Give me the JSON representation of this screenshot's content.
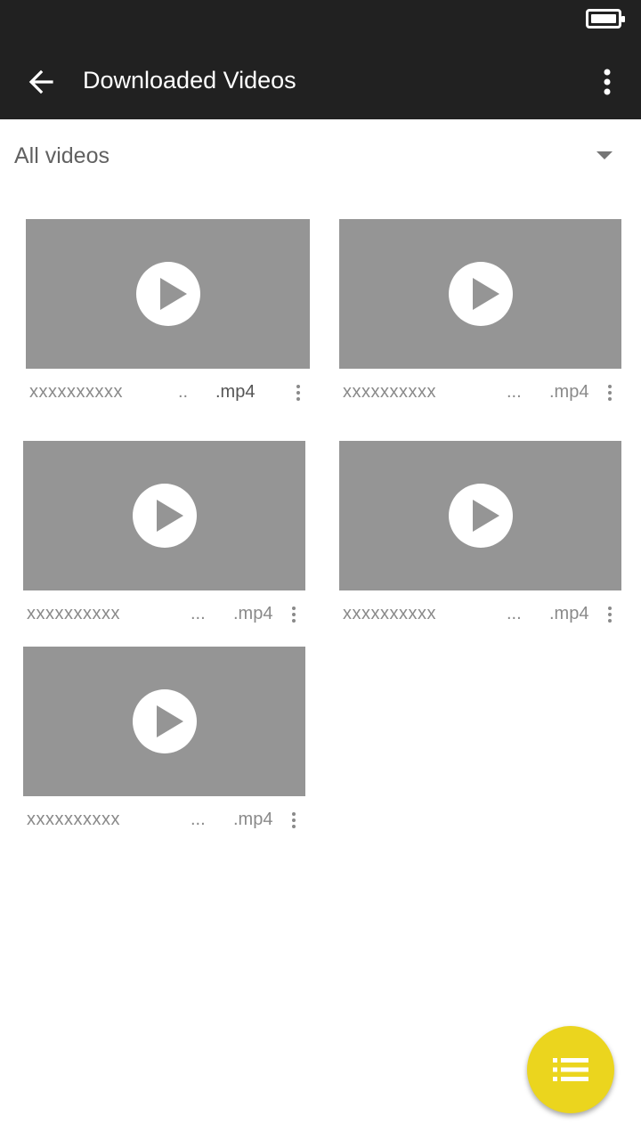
{
  "app_bar": {
    "title": "Downloaded Videos"
  },
  "filter": {
    "label": "All videos"
  },
  "videos": [
    {
      "name": "xxxxxxxxxx",
      "ellipsis": "..",
      "ext": ".mp4"
    },
    {
      "name": "xxxxxxxxxx",
      "ellipsis": "...",
      "ext": ".mp4"
    },
    {
      "name": "xxxxxxxxxx",
      "ellipsis": "...",
      "ext": ".mp4"
    },
    {
      "name": "xxxxxxxxxx",
      "ellipsis": "...",
      "ext": ".mp4"
    },
    {
      "name": "xxxxxxxxxx",
      "ellipsis": "...",
      "ext": ".mp4"
    }
  ],
  "colors": {
    "app_bar": "#212121",
    "thumbnail": "#959595",
    "fab": "#ebd51e"
  },
  "icons": {
    "back": "arrow-back-icon",
    "overflow": "more-vert-icon",
    "dropdown": "arrow-drop-down-icon",
    "play": "play-circle-icon",
    "fab": "list-icon",
    "battery": "battery-icon"
  }
}
